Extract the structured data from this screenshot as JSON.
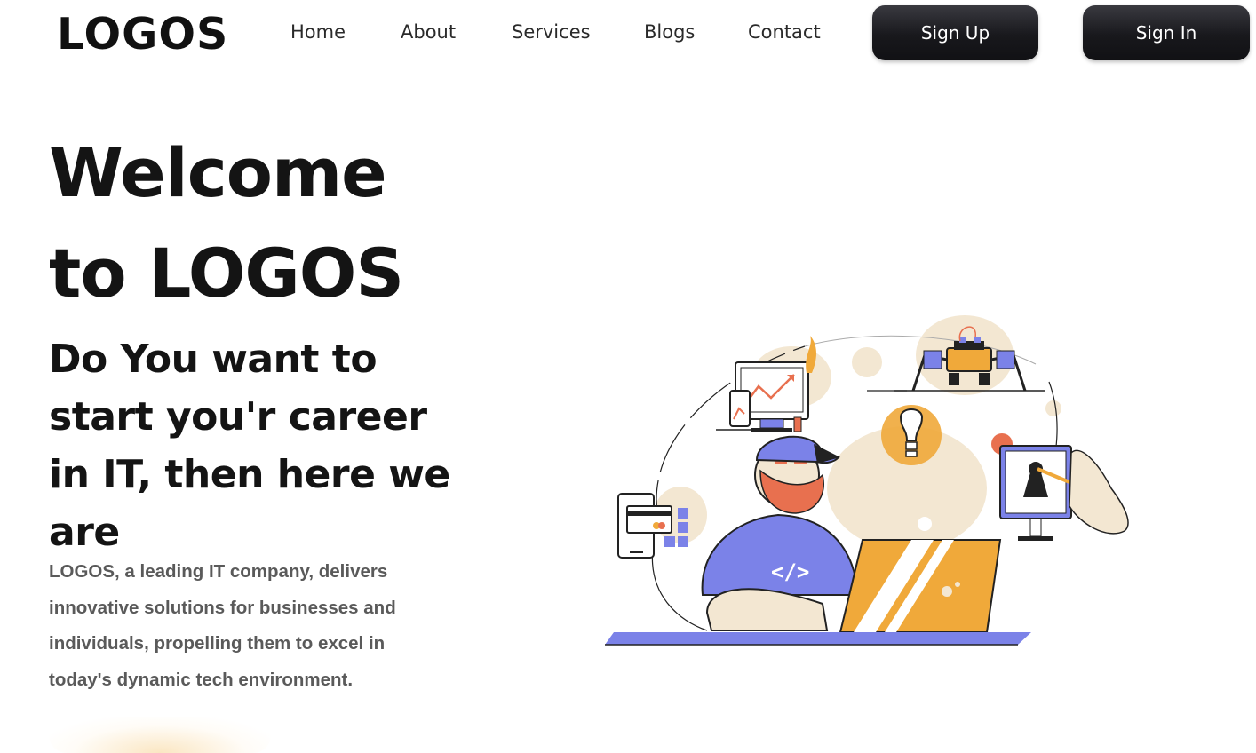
{
  "brand": {
    "logo_text": "LOGOS"
  },
  "nav": {
    "items": [
      {
        "label": "Home"
      },
      {
        "label": "About"
      },
      {
        "label": "Services"
      },
      {
        "label": "Blogs"
      },
      {
        "label": "Contact"
      }
    ]
  },
  "auth": {
    "sign_up_label": "Sign Up",
    "sign_in_label": "Sign In"
  },
  "hero": {
    "title_line1": "Welcome",
    "title_line2": "to LOGOS",
    "subtitle": "Do You want to start you'r career in IT, then here we are",
    "description": "LOGOS, a leading IT company, delivers innovative solutions for businesses and individuals, propelling them to excel in today's dynamic tech environment.",
    "code_symbol": "</>"
  },
  "colors": {
    "accent_purple": "#7b82e8",
    "accent_orange": "#f0a93a",
    "accent_red": "#e8704f",
    "cream": "#f3e7d2",
    "button_dark": "#17171b"
  },
  "icons": [
    "developer-illustration",
    "chart-monitor-icon",
    "phone-icon",
    "robot-icon",
    "lightbulb-icon",
    "payment-card-icon",
    "keyhole-monitor-icon",
    "key-icon"
  ]
}
